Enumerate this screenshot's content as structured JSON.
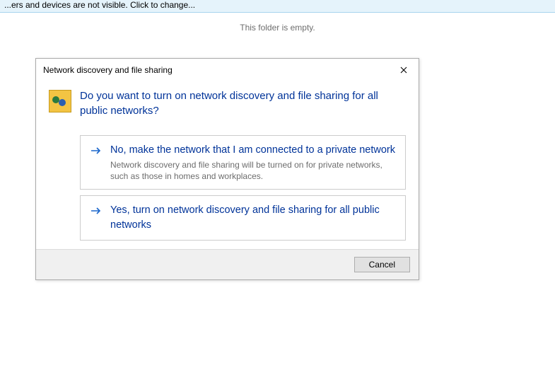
{
  "info_bar": "...ers and devices are not visible. Click to change...",
  "empty_folder_msg": "This folder is empty.",
  "dialog": {
    "title": "Network discovery and file sharing",
    "question": "Do you want to turn on network discovery and file sharing for all public networks?",
    "options": [
      {
        "title": "No, make the network that I am connected to a private network",
        "desc": "Network discovery and file sharing will be turned on for private networks, such as those in homes and workplaces."
      },
      {
        "title": "Yes, turn on network discovery and file sharing for all public networks",
        "desc": ""
      }
    ],
    "cancel_label": "Cancel"
  }
}
